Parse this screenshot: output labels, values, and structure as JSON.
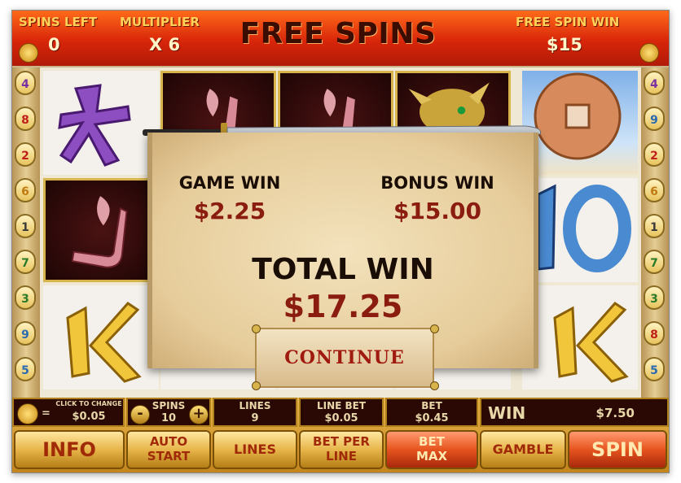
{
  "top_bar": {
    "spins_left_label": "SPINS LEFT",
    "spins_left_value": "0",
    "multiplier_label": "MULTIPLIER",
    "multiplier_value": "X 6",
    "title": "FREE SPINS",
    "free_spin_win_label": "FREE SPIN WIN",
    "free_spin_win_value": "$15"
  },
  "paylines_left": [
    "4",
    "8",
    "2",
    "6",
    "1",
    "7",
    "3",
    "9",
    "5"
  ],
  "paylines_right": [
    "4",
    "9",
    "2",
    "6",
    "1",
    "7",
    "3",
    "8",
    "5"
  ],
  "reel_symbols": [
    [
      "purple-glyph",
      "red-glyph",
      "gold-k"
    ],
    [
      "red-glyph",
      "red-glyph",
      "gold-k"
    ],
    [
      "red-glyph",
      "scroll",
      "scroll"
    ],
    [
      "gold-dragon",
      "scroll",
      "scroll"
    ],
    [
      "coin",
      "blue-glyph",
      "gold-k"
    ]
  ],
  "popup": {
    "game_win_label": "GAME WIN",
    "game_win_value": "$2.25",
    "bonus_win_label": "BONUS WIN",
    "bonus_win_value": "$15.00",
    "total_win_label": "TOTAL WIN",
    "total_win_value": "$17.25",
    "continue_label": "CONTINUE"
  },
  "panel": {
    "coin_hint": "CLICK TO CHANGE",
    "coin_equals": "=",
    "coin_value": "$0.05",
    "spins_label": "SPINS",
    "spins_value": "10",
    "minus_label": "-",
    "plus_label": "+",
    "lines_label": "LINES",
    "lines_value": "9",
    "line_bet_label": "LINE BET",
    "line_bet_value": "$0.05",
    "bet_label": "BET",
    "bet_value": "$0.45",
    "win_label": "WIN",
    "win_value": "$7.50"
  },
  "buttons": {
    "info": "INFO",
    "auto_start_1": "AUTO",
    "auto_start_2": "START",
    "lines": "LINES",
    "bet_per_line_1": "BET PER",
    "bet_per_line_2": "LINE",
    "bet_max_1": "BET",
    "bet_max_2": "MAX",
    "gamble": "GAMBLE",
    "spin": "SPIN"
  },
  "colors": {
    "popup_value": "#8a1c10",
    "accent_gold": "#e7b54a",
    "top_red": "#d8260a"
  }
}
